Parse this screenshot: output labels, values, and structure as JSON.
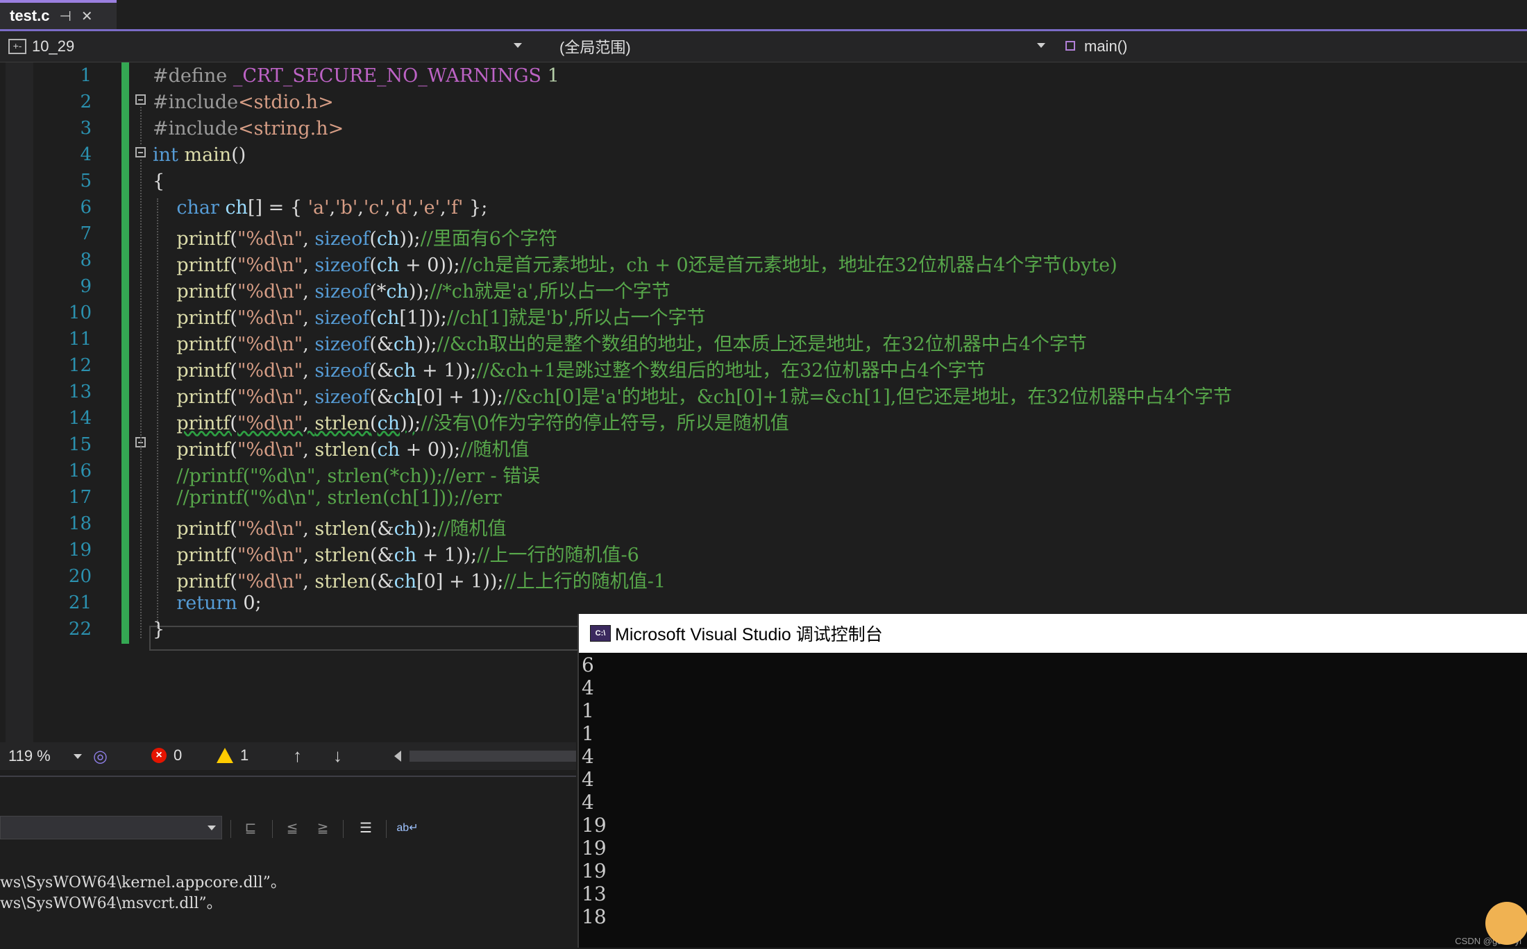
{
  "tab": {
    "title": "test.c",
    "pin_icon": "pin-icon",
    "close_icon": "close-icon"
  },
  "navbar": {
    "project": "10_29",
    "scope": "(全局范围)",
    "member": "main()"
  },
  "editor": {
    "line_numbers": [
      "1",
      "2",
      "3",
      "4",
      "5",
      "6",
      "7",
      "8",
      "9",
      "10",
      "11",
      "12",
      "13",
      "14",
      "15",
      "16",
      "17",
      "18",
      "19",
      "20",
      "21",
      "22"
    ]
  },
  "status": {
    "zoom": "119 %",
    "errors": "0",
    "warnings": "1"
  },
  "output": {
    "lines": [
      "ws\\SysWOW64\\kernel.appcore.dll”。",
      "ws\\SysWOW64\\msvcrt.dll”。"
    ]
  },
  "console": {
    "title": "Microsoft Visual Studio 调试控制台",
    "icon_label": "C:\\",
    "output": [
      "6",
      "4",
      "1",
      "1",
      "4",
      "4",
      "4",
      "19",
      "19",
      "19",
      "13",
      "18"
    ]
  },
  "watermark": "CSDN @gu••••yi"
}
